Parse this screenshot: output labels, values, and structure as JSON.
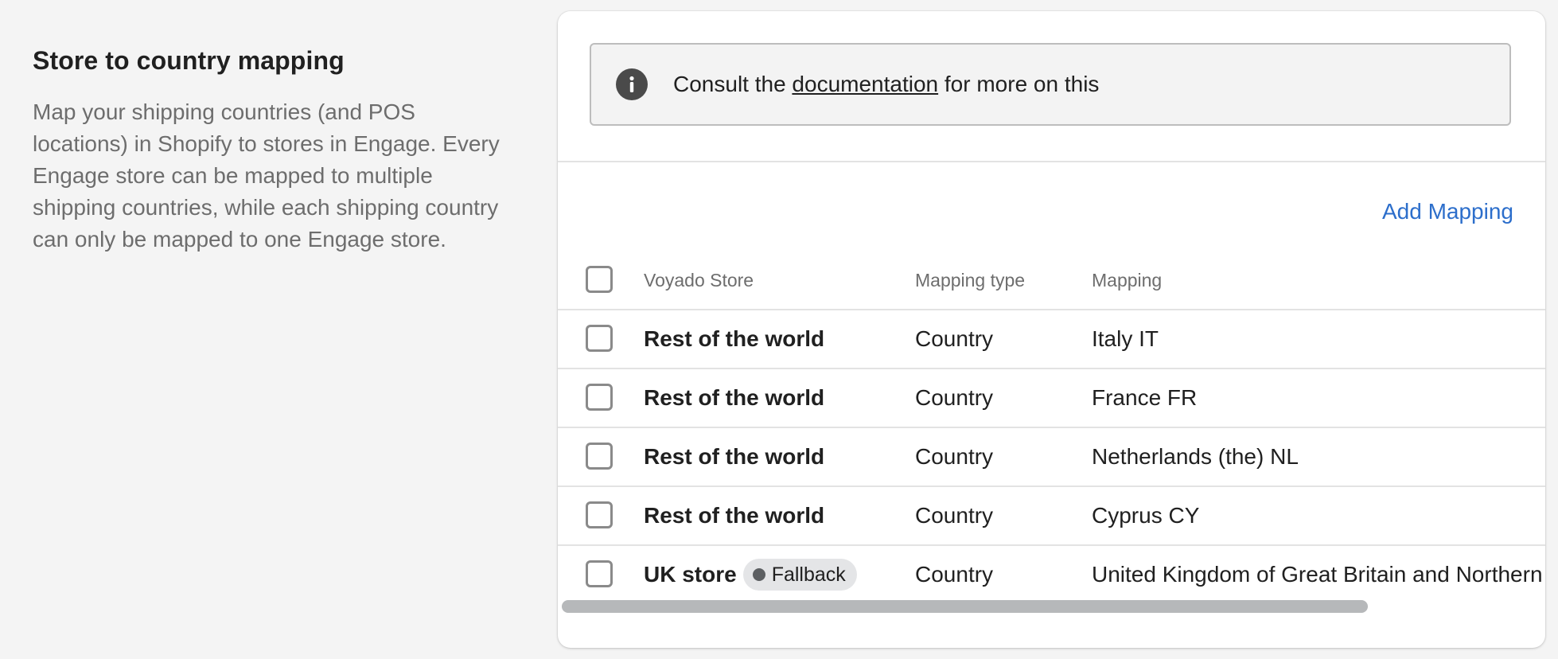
{
  "section": {
    "title": "Store to country mapping",
    "description": "Map your shipping countries (and POS locations) in Shopify to stores in Engage. Every Engage store can be mapped to multiple shipping countries, while each shipping country can only be mapped to one Engage store."
  },
  "banner": {
    "icon": "info-icon",
    "text_before": "Consult the ",
    "link_text": "documentation",
    "text_after": " for more on this"
  },
  "actions": {
    "add_mapping_label": "Add Mapping"
  },
  "table": {
    "columns": [
      "Voyado Store",
      "Mapping type",
      "Mapping"
    ],
    "rows": [
      {
        "store": "Rest of the world",
        "badge": "",
        "type": "Country",
        "mapping": "Italy IT"
      },
      {
        "store": "Rest of the world",
        "badge": "",
        "type": "Country",
        "mapping": "France FR"
      },
      {
        "store": "Rest of the world",
        "badge": "",
        "type": "Country",
        "mapping": "Netherlands (the) NL"
      },
      {
        "store": "Rest of the world",
        "badge": "",
        "type": "Country",
        "mapping": "Cyprus CY"
      },
      {
        "store": "UK store",
        "badge": "Fallback",
        "type": "Country",
        "mapping": "United Kingdom of Great Britain and Northern Ireland (the) GB"
      }
    ]
  },
  "colors": {
    "link": "#2c6ecb",
    "page_bg": "#f4f4f4",
    "banner_bg": "#f3f3f3"
  }
}
